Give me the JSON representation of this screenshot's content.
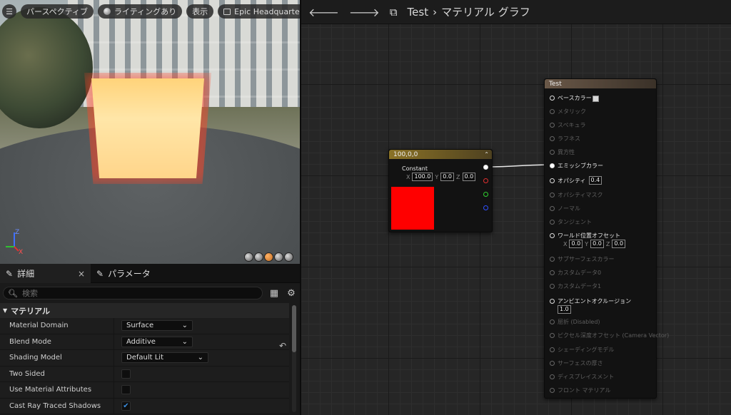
{
  "viewport": {
    "menu_icon": "hamburger-icon",
    "perspective": "パースペクティブ",
    "lighting": "ライティングあり",
    "show": "表示",
    "level": "Epic Headquarters",
    "axis_z": "Z",
    "axis_x": "X"
  },
  "details": {
    "tab_details": "詳細",
    "tab_params": "パラメータ",
    "search_placeholder": "検索",
    "section": "マテリアル",
    "props": [
      {
        "name": "Material Domain",
        "value": "Surface"
      },
      {
        "name": "Blend Mode",
        "value": "Additive"
      },
      {
        "name": "Shading Model",
        "value": "Default Lit"
      },
      {
        "name": "Two Sided",
        "checked": false
      },
      {
        "name": "Use Material Attributes",
        "checked": false
      },
      {
        "name": "Cast Ray Traced Shadows",
        "checked": true
      }
    ]
  },
  "graph": {
    "crumb_asset": "Test",
    "crumb_sep": "›",
    "crumb_graph": "マテリアル グラフ",
    "constant_node": {
      "title": "100,0,0",
      "label": "Constant",
      "x_label": "X",
      "x": "100.0",
      "y_label": "Y",
      "y": "0.0",
      "z_label": "Z",
      "z": "0.0",
      "color": "#ff0000"
    },
    "result_node": {
      "title": "Test",
      "pins": [
        {
          "label": "ベースカラー",
          "active": true
        },
        {
          "label": "メタリック",
          "active": false
        },
        {
          "label": "スペキュラ",
          "active": false
        },
        {
          "label": "ラフネス",
          "active": false
        },
        {
          "label": "異方性",
          "active": false
        },
        {
          "label": "エミッシブカラー",
          "active": true
        },
        {
          "label": "オパシティ",
          "active": true,
          "value": "0.4"
        },
        {
          "label": "オパシティマスク",
          "active": false
        },
        {
          "label": "ノーマル",
          "active": false
        },
        {
          "label": "タンジェント",
          "active": false
        },
        {
          "label": "ワールド位置オフセット",
          "active": true
        },
        {
          "label": "サブサーフェスカラー",
          "active": false
        },
        {
          "label": "カスタムデータ0",
          "active": false
        },
        {
          "label": "カスタムデータ1",
          "active": false
        },
        {
          "label": "アンビエントオクルージョン",
          "active": true,
          "value": "1.0"
        },
        {
          "label": "屈折 (Disabled)",
          "active": false
        },
        {
          "label": "ピクセル深度オフセット (Camera Vector)",
          "active": false
        },
        {
          "label": "シェーディングモデル",
          "active": false
        },
        {
          "label": "サーフェスの厚さ",
          "active": false
        },
        {
          "label": "ディスプレイスメント",
          "active": false
        },
        {
          "label": "フロント マテリアル",
          "active": false
        }
      ],
      "wpo": {
        "x_label": "X",
        "x": "0.0",
        "y_label": "Y",
        "y": "0.0",
        "z_label": "Z",
        "z": "0.0"
      }
    }
  },
  "colors": {
    "constant_header": "#7a6420",
    "result_header": "#5a4b3e",
    "wire": "#e8e8e8",
    "red_pin": "#e03030",
    "green_pin": "#30d030",
    "blue_pin": "#3050ff"
  }
}
